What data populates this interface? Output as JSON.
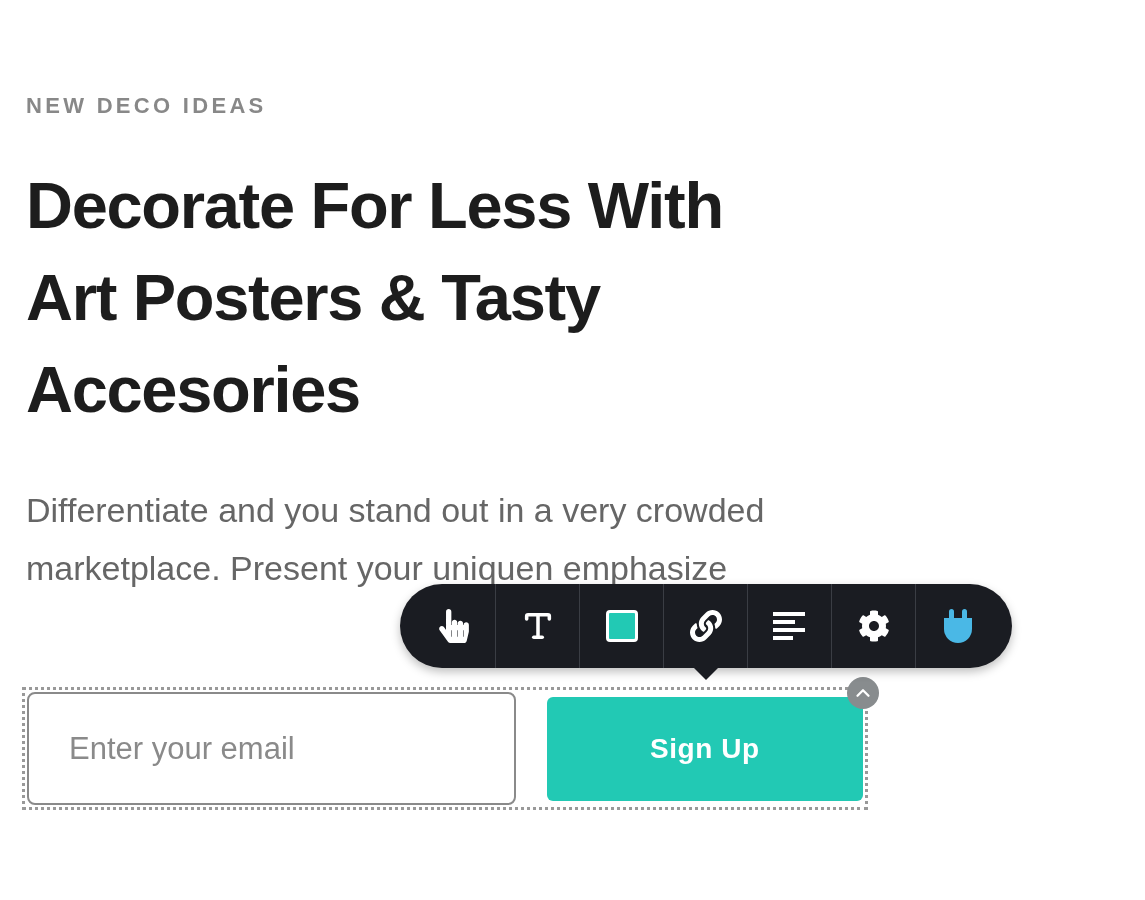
{
  "eyebrow": "NEW DECO IDEAS",
  "heading": "Decorate For Less With Art Posters & Tasty Accesories",
  "paragraph": "Differentiate and you stand out in a very crowded marketplace. Present your uniquen emphasize",
  "toolbar": {
    "tools": [
      {
        "kind": "pointer"
      },
      {
        "kind": "text"
      },
      {
        "kind": "color",
        "color": "#22c9b4"
      },
      {
        "kind": "link"
      },
      {
        "kind": "align"
      },
      {
        "kind": "settings"
      },
      {
        "kind": "plugin"
      }
    ]
  },
  "form": {
    "selected": true,
    "email": {
      "placeholder": "Enter your email"
    },
    "button": {
      "label": "Sign Up"
    }
  }
}
